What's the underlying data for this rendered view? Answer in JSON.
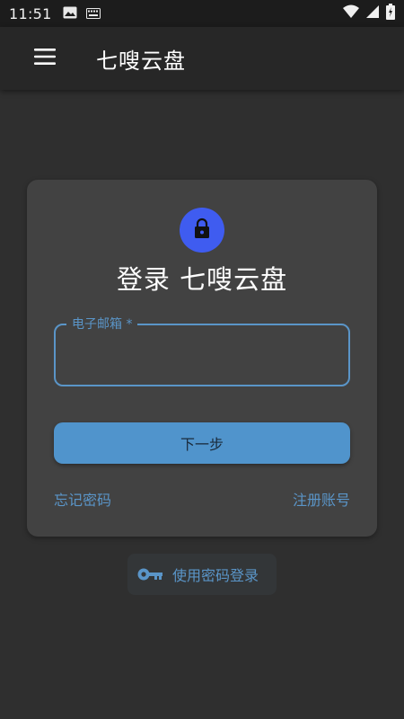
{
  "status_bar": {
    "time": "11:51",
    "icons": [
      "image-icon",
      "keyboard-icon",
      "wifi-icon",
      "signal-icon",
      "battery-icon"
    ]
  },
  "app_bar": {
    "menu_icon": "menu-icon",
    "title": "七嗖云盘"
  },
  "login_card": {
    "avatar_icon": "lock-icon",
    "title": "登录 七嗖云盘",
    "email_field": {
      "label": "电子邮箱 *",
      "value": ""
    },
    "next_button": "下一步",
    "forgot_password": "忘记密码",
    "register": "注册账号"
  },
  "password_login": {
    "icon": "key-icon",
    "label": "使用密码登录"
  },
  "colors": {
    "background": "#2f2f2f",
    "app_bar": "#272727",
    "card": "#424242",
    "accent": "#5a95c8",
    "button": "#5094cc",
    "avatar": "#3f5cf0"
  }
}
